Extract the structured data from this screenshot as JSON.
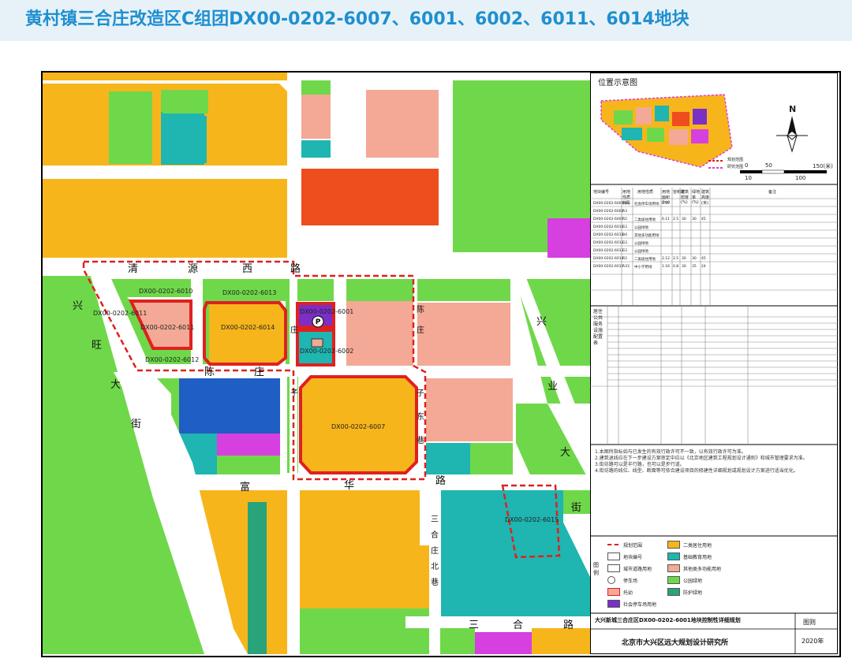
{
  "header": {
    "title": "黄村镇三合庄改造区C组团DX00-0202-6007、6001、6002、6011、6014地块"
  },
  "map": {
    "roads": {
      "qingyuanxi": [
        "清",
        "源",
        "西",
        "路"
      ],
      "chenzhuang": [
        "陈",
        "庄"
      ],
      "chenzhuang_alt": [
        "陈",
        "庄"
      ],
      "zhuangzi": [
        "庄",
        "子"
      ],
      "fuhua": [
        "富",
        "华",
        "路"
      ],
      "xingye": [
        "兴",
        "业",
        "大",
        "街"
      ],
      "xingwang": [
        "兴",
        "旺",
        "大",
        "街"
      ],
      "sanhe": [
        "三",
        "合",
        "路"
      ],
      "sanhezhuangbei": [
        "三",
        "合",
        "庄",
        "北",
        "巷"
      ],
      "chenzhuangzi": [
        "陈",
        "庄",
        "子",
        "东",
        "巷"
      ]
    },
    "parcels": {
      "p6010": "DX00-0202-6010",
      "p6013": "DX00-0202-6013",
      "p6001": "DX00-0202-6001",
      "p6011": "DX00-0202-6011",
      "p6011a": "DX00-0202-6011",
      "p6014": "DX00-0202-6014",
      "p6012": "DX00-0202-6012",
      "p6002": "DX00-0202-6002",
      "p6007": "DX00-0202-6007",
      "p6015": "DX00-0202-6015"
    },
    "symbols": {
      "parking": "P"
    },
    "colors": {
      "residential": "#f7b51c",
      "education": "#1fb5b0",
      "commercial": "#f3a995",
      "park": "#6fd84a",
      "protection": "#28a37a",
      "public_parking": "#7b2fc6",
      "public_service": "#ee4d1d",
      "blue": "#1f5ec4",
      "magenta": "#d63fe0",
      "road": "#ffffff",
      "boundary": "#e02020"
    }
  },
  "side": {
    "location_title": "位置示意图",
    "north": "N",
    "scale": {
      "labels": [
        "0",
        "50",
        "150(米)",
        "10",
        "100"
      ]
    },
    "legend_mini": [
      "规划范围",
      "研究范围"
    ],
    "table_headers": [
      "地块编号",
      "用地性质代码",
      "用地性质",
      "用地面积(ha)",
      "容积率",
      "建筑密度(%)",
      "绿地率(%)",
      "建筑高度(米)",
      "备注"
    ],
    "table_rows": [
      [
        "DX00-0202-6001",
        "S42",
        "社会停车场用地",
        "0.57",
        "",
        "",
        "",
        "",
        ""
      ],
      [
        "DX00-0202-6002",
        "A3",
        "",
        "",
        "",
        "",
        "",
        "",
        ""
      ],
      [
        "DX00-0202-6007",
        "R2",
        "二类居住用地",
        "6.11",
        "2.5",
        "30",
        "30",
        "45",
        ""
      ],
      [
        "DX00-0202-6010",
        "G1",
        "公园绿地",
        "",
        "",
        "",
        "",
        "",
        ""
      ],
      [
        "DX00-0202-6011",
        "B4",
        "其他多功能用地",
        "",
        "",
        "",
        "",
        "",
        ""
      ],
      [
        "DX00-0202-6012",
        "G1",
        "公园绿地",
        "",
        "",
        "",
        "",
        "",
        ""
      ],
      [
        "DX00-0202-6013",
        "G1",
        "公园绿地",
        "",
        "",
        "",
        "",
        "",
        ""
      ],
      [
        "DX00-0202-6014",
        "R2",
        "二类居住用地",
        "2.12",
        "2.5",
        "30",
        "30",
        "45",
        ""
      ],
      [
        "DX00-0202-6015",
        "A33",
        "中小学用地",
        "1.16",
        "0.8",
        "30",
        "35",
        "24",
        ""
      ]
    ],
    "service_title": "居住公共服务设施配置表",
    "notes": [
      "1.本图所指标如与已发生的有效行政许可不一致，以有效行政许可为准。",
      "2.建筑退线应在下一步建设方案审定中应以《北京地区建筑工程规划设计通则》和城市管理要求为准。",
      "3.街坊路可以是半行路，也可以是步行道。",
      "4.街坊路的线位、线型、断面等可依合建设项目的修建性详细规划或规划设计方案进行适当优化。"
    ],
    "legend_title": "图例",
    "legend": [
      {
        "label": "规划范围",
        "type": "boundary"
      },
      {
        "label": "二类居住用地",
        "color": "#f7b51c"
      },
      {
        "label": "地块编号",
        "type": "code"
      },
      {
        "label": "基础教育用地",
        "color": "#1fb5b0"
      },
      {
        "label": "城市道路用地",
        "type": "road"
      },
      {
        "label": "其他类多功能用地",
        "color": "#f3a995"
      },
      {
        "label": "停车场",
        "type": "parking"
      },
      {
        "label": "公园绿地",
        "color": "#6fd84a"
      },
      {
        "label": "托幼",
        "type": "kinder"
      },
      {
        "label": "防护绿地",
        "color": "#28a37a"
      },
      {
        "label": "社会停车场用地",
        "color": "#7b2fc6"
      }
    ],
    "footer_title": "大兴新城三合庄区DX00-0202-6001地块控制性详细规划",
    "footer_org": "北京市大兴区远大规划设计研究所",
    "footer_year": "2020年",
    "footer_type": "图则"
  }
}
